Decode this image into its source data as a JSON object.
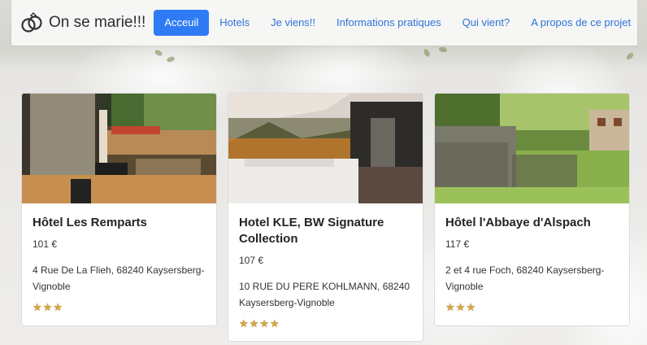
{
  "navbar": {
    "brand": "On se marie!!!",
    "brand_icon": "rings-icon",
    "links": [
      {
        "label": "Acceuil",
        "active": true
      },
      {
        "label": "Hotels",
        "active": false
      },
      {
        "label": "Je viens!!",
        "active": false
      },
      {
        "label": "Informations pratiques",
        "active": false
      },
      {
        "label": "Qui vient?",
        "active": false
      },
      {
        "label": "A propos de ce projet",
        "active": false
      }
    ],
    "active_color": "#2f7bf5",
    "link_color": "#2e73d8"
  },
  "hotels": [
    {
      "name": "Hôtel Les Remparts",
      "price": "101 €",
      "address": "4 Rue De La Flieh, 68240 Kaysersberg-Vignoble",
      "stars": 3
    },
    {
      "name": "Hotel KLE, BW Signature Collection",
      "price": "107 €",
      "address": "10 RUE DU PERE KOHLMANN, 68240 Kaysersberg-Vignoble",
      "stars": 4
    },
    {
      "name": "Hôtel l'Abbaye d'Alspach",
      "price": "117 €",
      "address": "2 et 4 rue Foch, 68240 Kaysersberg-Vignoble",
      "stars": 3
    }
  ],
  "star_color": "#d8a640"
}
